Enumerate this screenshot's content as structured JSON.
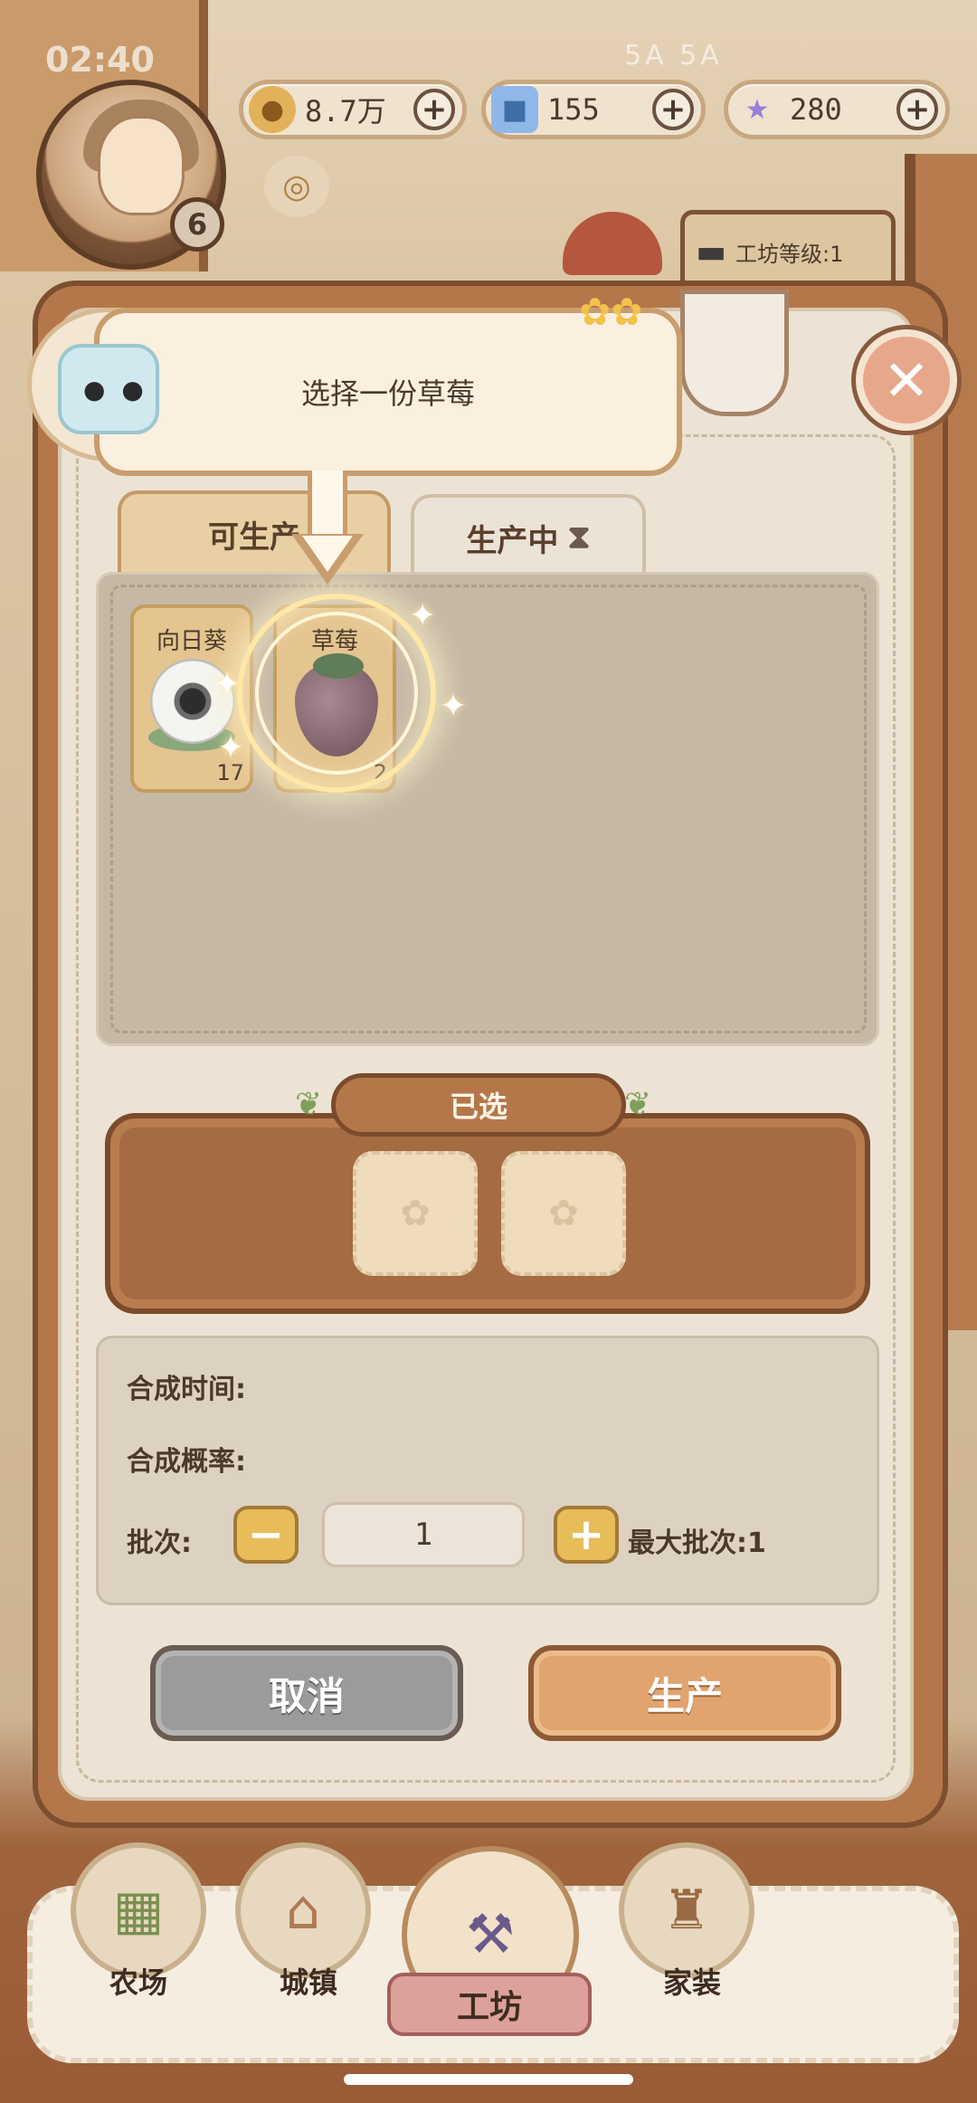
{
  "status_bar": {
    "time": "02:40",
    "signal": "5A 5A"
  },
  "currencies": [
    {
      "name": "coin",
      "value": "8.7万",
      "plus": "+"
    },
    {
      "name": "gem",
      "value": "155",
      "plus": "+"
    },
    {
      "name": "star",
      "value": "280",
      "plus": "+"
    }
  ],
  "player": {
    "level": "6"
  },
  "workshop": {
    "level_label": "工坊等级:1"
  },
  "tutorial": {
    "text": "选择一份草莓"
  },
  "close": "✕",
  "tabs": {
    "available": "可生产",
    "producing": "生产中"
  },
  "items": [
    {
      "name": "向日葵",
      "qty": "17"
    },
    {
      "name": "草莓",
      "qty": "2"
    }
  ],
  "selected": {
    "title": "已选"
  },
  "info": {
    "synthesis_time": "合成时间:",
    "synthesis_rate": "合成概率:",
    "batch_label": "批次:",
    "batch_value": "1",
    "max_batch": "最大批次:1",
    "minus": "−",
    "plus": "+"
  },
  "buttons": {
    "cancel": "取消",
    "produce": "生产"
  },
  "nav": {
    "farm": "农场",
    "town": "城镇",
    "workshop": "工坊",
    "home": "家装"
  }
}
